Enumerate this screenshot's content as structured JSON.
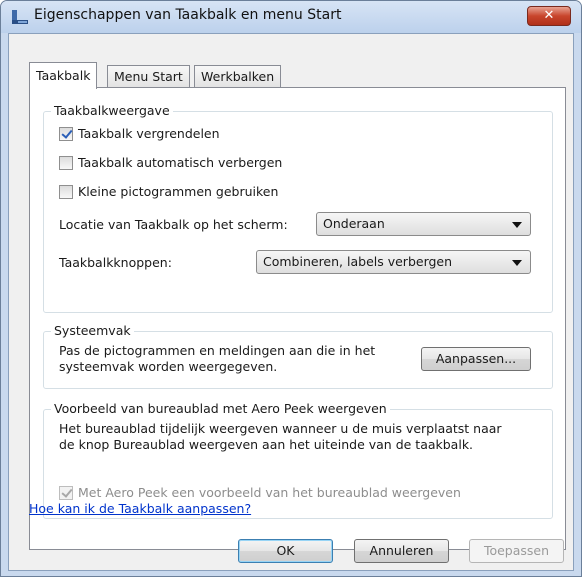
{
  "window": {
    "title": "Eigenschappen van Taakbalk en menu Start",
    "close_label": "✕"
  },
  "tabs": [
    {
      "label": "Taakbalk",
      "active": true
    },
    {
      "label": "Menu Start",
      "active": false
    },
    {
      "label": "Werkbalken",
      "active": false
    }
  ],
  "appearance": {
    "title": "Taakbalkweergave",
    "lock_label": "Taakbalk vergrendelen",
    "autohide_label": "Taakbalk automatisch verbergen",
    "small_icons_label": "Kleine pictogrammen gebruiken",
    "location_label": "Locatie van Taakbalk op het scherm:",
    "location_value": "Onderaan",
    "buttons_label": "Taakbalkknoppen:",
    "buttons_value": "Combineren, labels verbergen"
  },
  "tray": {
    "title": "Systeemvak",
    "description_line1": "Pas de pictogrammen en meldingen aan die in het",
    "description_line2": "systeemvak worden weergegeven.",
    "customize_label": "Aanpassen..."
  },
  "peek": {
    "title": "Voorbeeld van bureaublad met Aero Peek weergeven",
    "description_line1": "Het bureaublad tijdelijk weergeven wanneer u de muis verplaatst naar",
    "description_line2": "de knop Bureaublad weergeven aan het uiteinde van de taakbalk.",
    "checkbox_label": "Met Aero Peek een voorbeeld van het bureaublad weergeven"
  },
  "help_link": "Hoe kan ik de Taakbalk aanpassen?",
  "footer": {
    "ok_label": "OK",
    "cancel_label": "Annuleren",
    "apply_label": "Toepassen"
  }
}
